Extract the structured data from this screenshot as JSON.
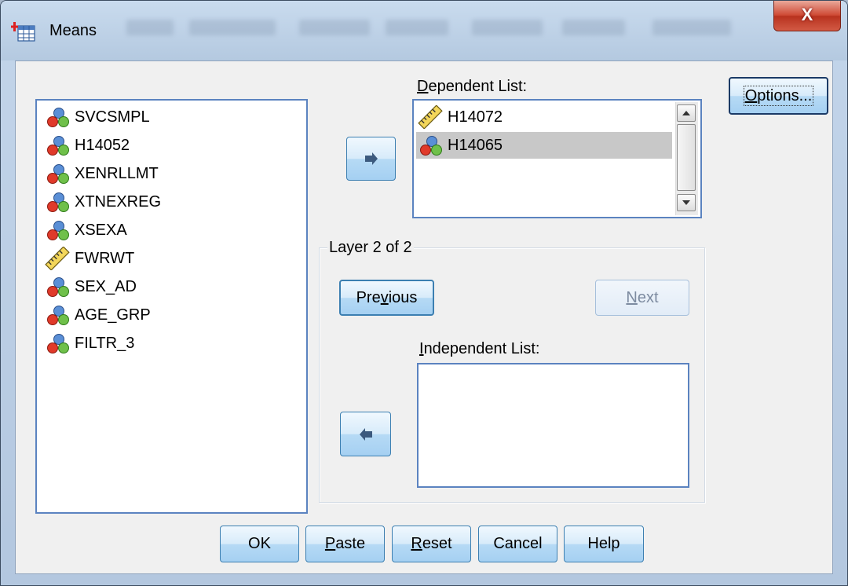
{
  "window": {
    "title": "Means",
    "close_label": "X"
  },
  "source_list": {
    "items": [
      {
        "label": "SVCSMPL",
        "icon": "nominal-variable-icon"
      },
      {
        "label": "H14052",
        "icon": "nominal-variable-icon"
      },
      {
        "label": "XENRLLMT",
        "icon": "nominal-variable-icon"
      },
      {
        "label": "XTNEXREG",
        "icon": "nominal-variable-icon"
      },
      {
        "label": "XSEXA",
        "icon": "nominal-variable-icon"
      },
      {
        "label": "FWRWT",
        "icon": "scale-variable-icon"
      },
      {
        "label": "SEX_AD",
        "icon": "nominal-variable-icon"
      },
      {
        "label": "AGE_GRP",
        "icon": "nominal-variable-icon"
      },
      {
        "label": "FILTR_3",
        "icon": "nominal-variable-icon"
      }
    ]
  },
  "dependent": {
    "label_u": "D",
    "label_rest": "ependent List:",
    "items": [
      {
        "label": "H14072",
        "icon": "scale-variable-icon",
        "selected": false
      },
      {
        "label": "H14065",
        "icon": "nominal-variable-icon",
        "selected": true
      }
    ]
  },
  "layer": {
    "title": "Layer 2 of 2",
    "previous_pre": "Pre",
    "previous_u": "v",
    "previous_post": "ious",
    "next_u": "N",
    "next_post": "ext",
    "independent_u": "I",
    "independent_rest": "ndependent List:"
  },
  "options": {
    "u": "O",
    "rest": "ptions..."
  },
  "footer": {
    "ok": "OK",
    "paste_u": "P",
    "paste_rest": "aste",
    "reset_u": "R",
    "reset_rest": "eset",
    "cancel": "Cancel",
    "help": "Help"
  },
  "colors": {
    "selection": "#c8c8c8",
    "accent": "#3c7fb1",
    "close": "#c84a35"
  }
}
